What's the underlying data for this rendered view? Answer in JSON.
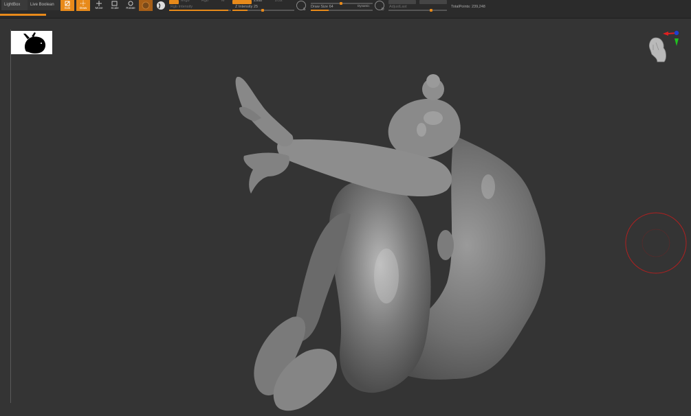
{
  "shelf": {
    "tabs": [
      {
        "label": "LightBox"
      },
      {
        "label": "Live Boolean"
      }
    ],
    "tools": {
      "edit": "Edit",
      "draw": "Draw",
      "move": "Move",
      "scale": "Scale",
      "rotate": "Rotate"
    },
    "rgb_intensity": "Rgb Intensity",
    "z_intensity": "Z Intensity 25",
    "draw_size": "Draw Size 64",
    "dynamic": "Dynamic",
    "s_label": "S",
    "d_label": "D",
    "adjust_last": "AdjustLast",
    "total_points": "TotalPoints: 239,248",
    "z_intensity_value": 25,
    "draw_size_value": 64
  },
  "colors": {
    "accent": "#e88a1a",
    "background": "#343434",
    "brush_ring": "#b02020"
  },
  "icons": {
    "edit": "edit-icon",
    "draw": "draw-icon",
    "move": "move-icon",
    "scale": "scale-icon",
    "rotate": "rotate-icon",
    "material": "material-icon",
    "alpha": "sphere-alpha-icon"
  }
}
